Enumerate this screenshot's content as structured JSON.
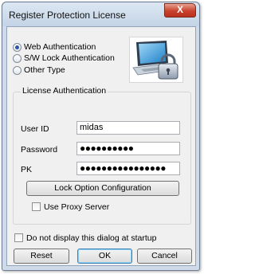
{
  "window": {
    "title": "Register Protection License",
    "close_glyph": "X"
  },
  "auth_type": {
    "options": [
      {
        "label": "Web Authentication",
        "selected": true
      },
      {
        "label": "S/W Lock Authentication",
        "selected": false
      },
      {
        "label": "Other Type",
        "selected": false
      }
    ]
  },
  "logo_icon": "laptop-padlock-icon",
  "license_group": {
    "title": "License Authentication",
    "user_id_label": "User ID",
    "user_id_value": "midas",
    "password_label": "Password",
    "password_value": "●●●●●●●●●●",
    "pk_label": "PK",
    "pk_value": "●●●●●●●●●●●●●●●●",
    "lock_option_button": "Lock Option Configuration",
    "use_proxy_label": "Use Proxy Server",
    "use_proxy_checked": false
  },
  "startup": {
    "label": "Do not display this dialog at startup",
    "checked": false
  },
  "buttons": {
    "reset": "Reset",
    "ok": "OK",
    "cancel": "Cancel"
  },
  "colors": {
    "title_bar": "#c4d4e6",
    "close_button": "#c8412d",
    "dialog_background": "#f0f0f0",
    "default_button_border": "#3c7fb1"
  }
}
